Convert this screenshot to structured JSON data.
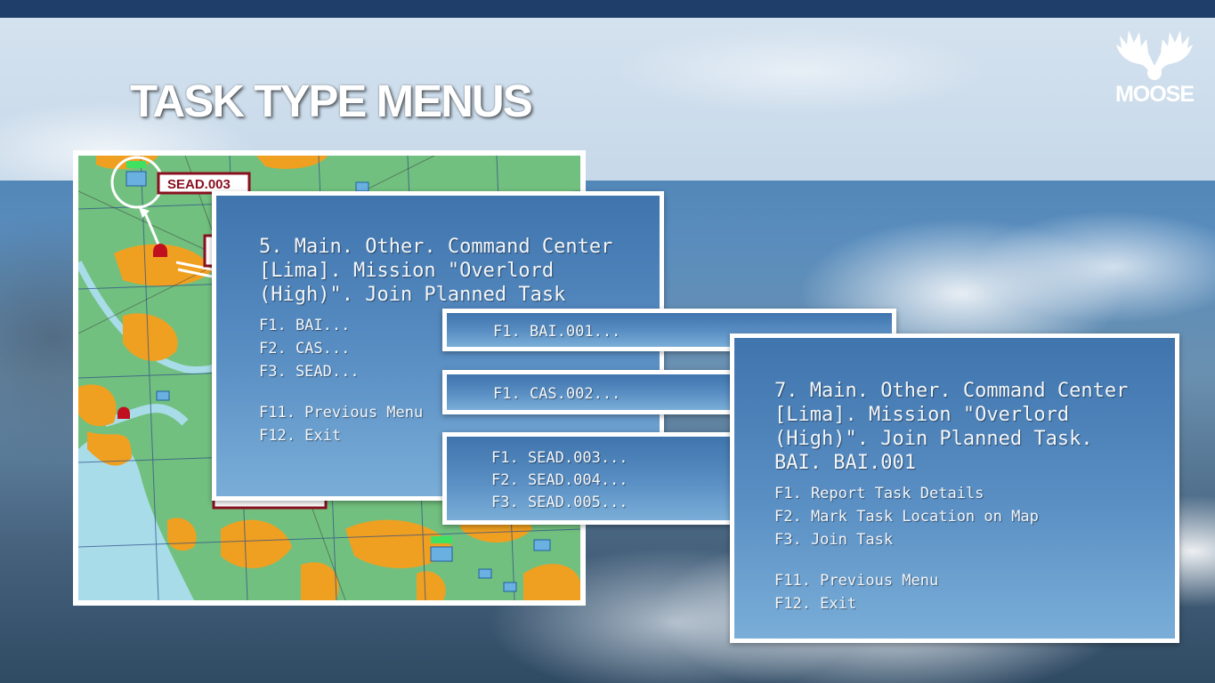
{
  "slide": {
    "title": "TASK TYPE MENUS",
    "logo_text": "MOOSE"
  },
  "map": {
    "marker_label": "SEAD.003"
  },
  "menu_main": {
    "title_lines": [
      "5. Main. Other. Command Center",
      "[Lima]. Mission \"Overlord",
      "(High)\". Join Planned Task"
    ],
    "items": [
      "F1. BAI...",
      "F2. CAS...",
      "F3. SEAD..."
    ],
    "nav": [
      "F11. Previous Menu",
      "F12. Exit"
    ]
  },
  "menu_bai": {
    "items": [
      "F1. BAI.001..."
    ]
  },
  "menu_cas": {
    "items": [
      "F1. CAS.002..."
    ]
  },
  "menu_sead": {
    "items": [
      "F1. SEAD.003...",
      "F2. SEAD.004...",
      "F3. SEAD.005..."
    ]
  },
  "menu_task": {
    "title_lines": [
      "7. Main. Other. Command Center",
      "[Lima]. Mission \"Overlord",
      "(High)\". Join Planned Task.",
      "BAI. BAI.001"
    ],
    "items": [
      "F1. Report Task Details",
      "F2. Mark Task Location on Map",
      "F3. Join Task"
    ],
    "nav": [
      "F11. Previous Menu",
      "F12. Exit"
    ]
  },
  "colors": {
    "panel_blue": "#4a80b8",
    "map_green": "#6dbb7a",
    "map_orange": "#f0a020",
    "marker_red": "#b01020"
  }
}
